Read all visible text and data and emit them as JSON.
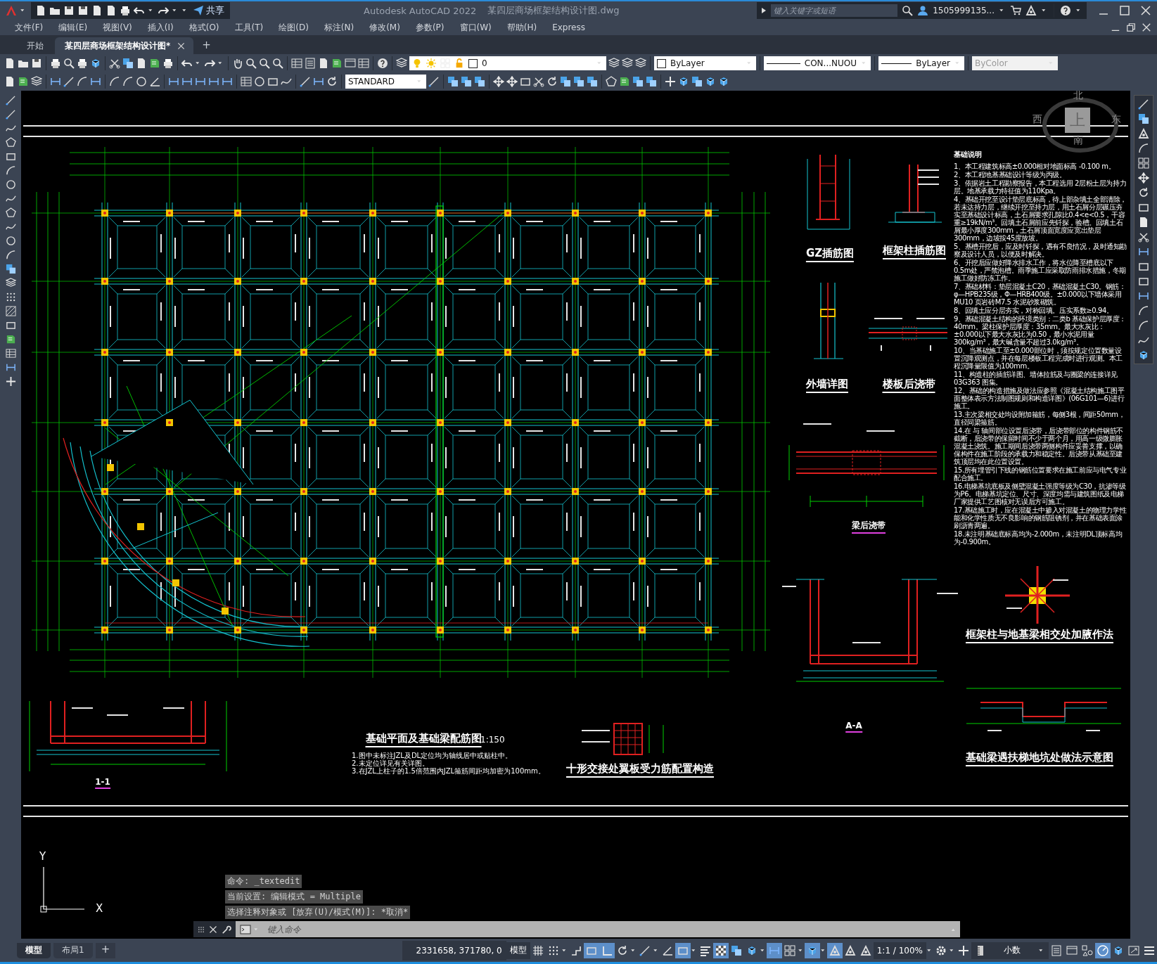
{
  "title_bar": {
    "app_title": "Autodesk AutoCAD 2022",
    "file_name": "某四层商场框架结构设计图.dwg",
    "share": "共享",
    "search": {
      "placeholder": "键入关键字或短语"
    },
    "user": "1505999135..."
  },
  "menu": [
    "文件(F)",
    "编辑(E)",
    "视图(V)",
    "插入(I)",
    "格式(O)",
    "工具(T)",
    "绘图(D)",
    "标注(N)",
    "修改(M)",
    "参数(P)",
    "窗口(W)",
    "帮助(H)",
    "Express"
  ],
  "tabs": [
    {
      "label": "开始",
      "selected": false
    },
    {
      "label": "某四层商场框架结构设计图*",
      "selected": true
    }
  ],
  "new_tab": "+",
  "toolbar": {
    "layer": {
      "value": "0"
    },
    "color": {
      "value": "ByLayer"
    },
    "linetype": {
      "value": "CON...NUOU"
    },
    "lineweight": {
      "value": "ByLayer"
    },
    "plot_style": {
      "value": "ByColor",
      "disabled": true
    },
    "text_style": {
      "value": "STANDARD"
    }
  },
  "viewcube": {
    "north": "北",
    "west": "西",
    "top": "上",
    "east": "东",
    "south": "南"
  },
  "drawing": {
    "labels": [
      {
        "kind": "title",
        "text": "GZ插筋图"
      },
      {
        "kind": "title",
        "text": "框架柱插筋图"
      },
      {
        "kind": "title",
        "text": "外墙详图"
      },
      {
        "kind": "title",
        "text": "楼板后浇带"
      },
      {
        "kind": "small",
        "text": "梁后浇带"
      },
      {
        "kind": "title",
        "text": "框架柱与地基梁相交处加腋作法"
      },
      {
        "kind": "title",
        "text": "基础平面及基础梁配筋图"
      },
      {
        "kind": "scale",
        "text": "1:150"
      },
      {
        "kind": "title",
        "text": "十形交接处翼板受力筋配置构造"
      },
      {
        "kind": "small",
        "text": "A-A"
      },
      {
        "kind": "title",
        "text": "基础梁遇扶梯地坑处做法示意图"
      },
      {
        "kind": "small",
        "text": "1-1"
      }
    ],
    "plan_notes": [
      "1.图中未标注JZL及DL定位均为轴线居中或贴柱中。",
      "2.未定位详见有关详图。",
      "3.在JZL上柱子的1.5倍范围内JZL箍筋间距均加密为100mm。"
    ],
    "notes_title": "基础说明",
    "notes": [
      "1、本工程建筑标高±0.000相对地面标高 -0.100 m。",
      "2、本工程地基基础设计等级为丙级。",
      "3、依据岩土工程勘察报告，本工程选用 2层粉土层为持力层。地基承载力特征值为110Kpa。",
      "4、基础开挖至设计垫层底标高，待上部杂填土全部清除，若未达持力层，继续开挖至持力层，用土石屑分层碾压夯实至基础设计标高，土石屑要求孔隙比0.4<e<0.5，干容重≥19kN/m³。回填土石屑前应先钎探，验槽。回填土石屑最小厚度300mm，土石屑顶面宽度应宽出垫层300mm，边坡按45度放坡。",
      "5、基槽开挖后，应及时钎探，遇有不良情况，及时通知勘察及设计人员，以便及时解决。",
      "6、开挖后应做好降水排水工作，将水位降至槽底以下0.5m处，严禁泡槽。雨季施工应采取防雨排水措施，冬期施工做好防冻工作。",
      "7、基础材料：垫层混凝土C20，基础混凝土C30。钢筋：φ—HPB235级，Φ—HRB400级。±0.000以下墙体采用MU10 页岩砖M7.5 水泥砂浆砌筑。",
      "8、回填土应分层夯实，对称回填。压实系数≥0.94。",
      "9、基础混凝土结构的环境类别：二类b 基础保护层厚度：40mm。梁柱保护层厚度：35mm。最大水灰比：±0.000以下最大水灰比为0.50，最小水泥用量300kg/m³，最大碱含量不超过3.0kg/m³。",
      "10、当基础施工至±0.000部位时，须按规定位置数量设置沉降观测点，并在每层楼板工程完成时进行观测。本工程沉降量限值为100mm。",
      "11、构造柱的插筋详图、墙体拉筋及与圈梁的连接详见 03G363 图集。",
      "12、基础的构造措施及做法应参照《混凝土结构施工图平面整体表示方法制图规则和构造详图》(06G101—6)进行施工。",
      "13.主次梁相交处均设附加箍筋，每侧3根，间距50mm，直径同梁箍筋。",
      "14.在 与 轴间部位设置后浇带，后浇带部位的构件钢筋不截断，后浇带的保留时间不少于两个月，用高一级微膨胀混凝土浇筑。施工期间后浇带两侧构件应妥善支撑，以确保构件在施工阶段的承载力和稳定性。后浇带从基础至建筑顶层均在此位置设置。",
      "15.所有埋管引下线的钢筋位置要求在施工前应与电气专业配合施工。",
      "16.电梯基坑底板及侧壁混凝土强度等级为C30，抗渗等级为P6。电梯基坑定位、尺寸、深度均需与建筑图纸及电梯厂家提供工艺图核对无误后方可施工。",
      "17.基础施工时，应在混凝土中掺入对混凝土的物理力学性能和化学性质无不良影响的钢筋阻锈剂，并在基础表面涂刷沥青两遍。",
      "18.未注明基础底标高均为-2.000m，未注明DL顶标高均为-0.900m。"
    ]
  },
  "axis": {
    "y": "Y",
    "x": "X"
  },
  "command_line": {
    "history": [
      "命令: _textedit",
      "当前设置: 编辑模式 = Multiple",
      "选择注释对象或 [放弃(U)/模式(M)]: *取消*"
    ],
    "input": {
      "placeholder": "键入命令"
    }
  },
  "status_bar": {
    "layouts": [
      {
        "label": "模型",
        "selected": true
      },
      {
        "label": "布局1",
        "selected": false
      }
    ],
    "add_layout": "+",
    "coordinates": "2331658, 371780, 0",
    "space": "模型",
    "toggles": [
      {
        "on": false
      },
      {
        "on": false
      },
      {
        "on": false
      },
      {
        "on": true
      },
      {
        "on": true
      },
      {
        "on": false
      },
      {
        "on": false
      },
      {
        "on": false
      },
      {
        "on": true
      },
      {
        "on": false
      },
      {
        "on": true
      },
      {
        "on": false
      },
      {
        "on": false
      },
      {
        "on": true
      },
      {
        "on": false
      },
      {
        "on": true
      },
      {
        "on": true
      },
      {
        "on": false
      },
      {
        "on": false
      }
    ],
    "annotation_scale": "1:1 / 100%",
    "units": "小数",
    "hardware_acceleration": {
      "on": true
    }
  }
}
